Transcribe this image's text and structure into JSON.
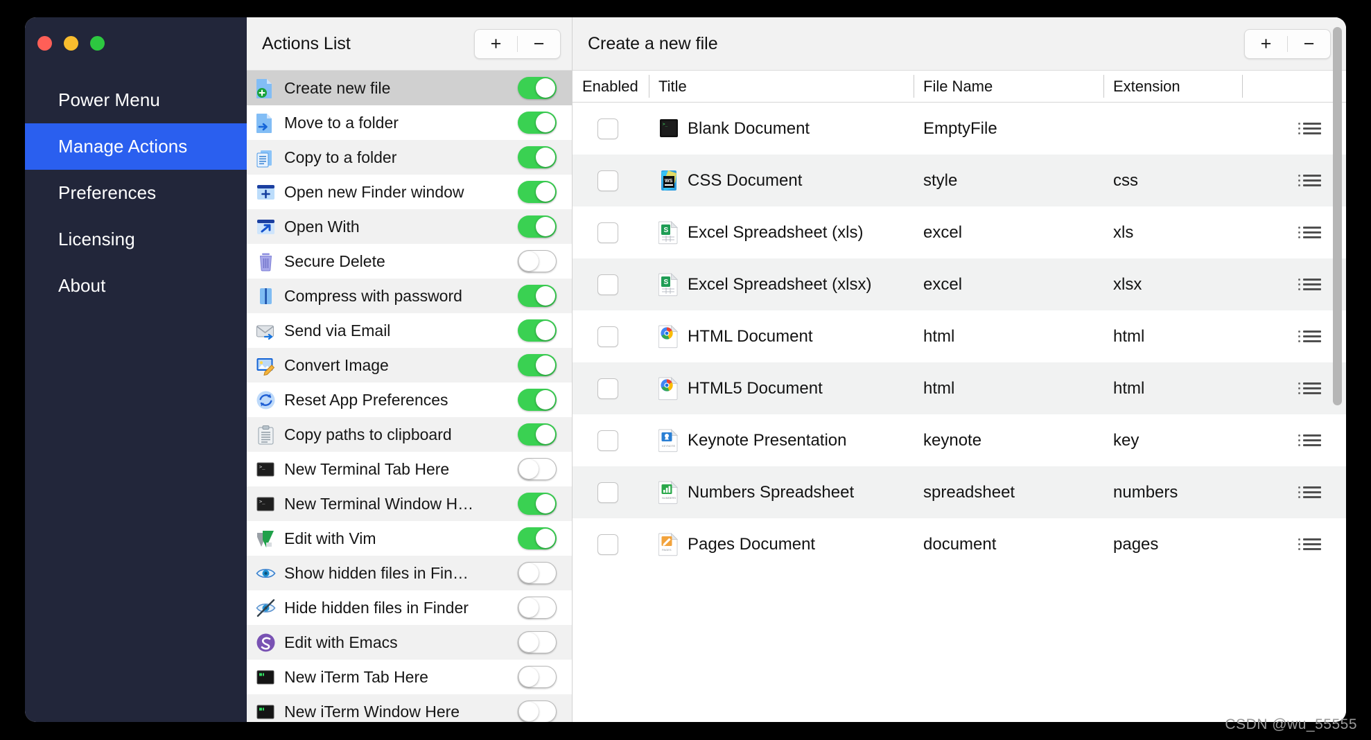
{
  "window": {
    "traffic_lights": [
      "close",
      "minimize",
      "zoom"
    ],
    "colors": {
      "sidebar_bg": "#22263a",
      "accent": "#2a5fef",
      "toggle_on": "#3ad152",
      "selected_row": "#d0d0d0"
    }
  },
  "sidebar": {
    "items": [
      {
        "label": "Power Menu",
        "active": false
      },
      {
        "label": "Manage Actions",
        "active": true
      },
      {
        "label": "Preferences",
        "active": false
      },
      {
        "label": "Licensing",
        "active": false
      },
      {
        "label": "About",
        "active": false
      }
    ]
  },
  "actions_panel": {
    "title": "Actions List",
    "add_label": "+",
    "remove_label": "−",
    "items": [
      {
        "label": "Create new file",
        "icon": "file-add-icon",
        "enabled": true,
        "selected": true
      },
      {
        "label": "Move to a folder",
        "icon": "file-move-icon",
        "enabled": true,
        "selected": false
      },
      {
        "label": "Copy to a folder",
        "icon": "file-copy-icon",
        "enabled": true,
        "selected": false
      },
      {
        "label": "Open new Finder window",
        "icon": "window-plus-icon",
        "enabled": true,
        "selected": false
      },
      {
        "label": "Open With",
        "icon": "open-with-arrow-icon",
        "enabled": true,
        "selected": false
      },
      {
        "label": "Secure Delete",
        "icon": "trash-icon",
        "enabled": false,
        "selected": false
      },
      {
        "label": "Compress with password",
        "icon": "archive-lock-icon",
        "enabled": true,
        "selected": false
      },
      {
        "label": "Send via Email",
        "icon": "envelope-send-icon",
        "enabled": true,
        "selected": false
      },
      {
        "label": "Convert Image",
        "icon": "image-edit-icon",
        "enabled": true,
        "selected": false
      },
      {
        "label": "Reset App Preferences",
        "icon": "refresh-circle-icon",
        "enabled": true,
        "selected": false
      },
      {
        "label": "Copy paths to clipboard",
        "icon": "clipboard-icon",
        "enabled": true,
        "selected": false
      },
      {
        "label": "New Terminal Tab Here",
        "icon": "terminal-icon",
        "enabled": false,
        "selected": false
      },
      {
        "label": "New Terminal Window H…",
        "icon": "terminal-icon",
        "enabled": true,
        "selected": false
      },
      {
        "label": "Edit with Vim",
        "icon": "vim-icon",
        "enabled": true,
        "selected": false
      },
      {
        "label": "Show hidden files in Fin…",
        "icon": "eye-icon",
        "enabled": false,
        "selected": false
      },
      {
        "label": "Hide hidden files in Finder",
        "icon": "eye-slash-icon",
        "enabled": false,
        "selected": false
      },
      {
        "label": "Edit with Emacs",
        "icon": "emacs-icon",
        "enabled": false,
        "selected": false
      },
      {
        "label": "New iTerm Tab Here",
        "icon": "iterm-icon",
        "enabled": false,
        "selected": false
      },
      {
        "label": "New iTerm Window Here",
        "icon": "iterm-icon",
        "enabled": false,
        "selected": false
      }
    ]
  },
  "detail_panel": {
    "title": "Create a new file",
    "add_label": "+",
    "remove_label": "−",
    "columns": [
      "Enabled",
      "Title",
      "File Name",
      "Extension",
      ""
    ],
    "rows": [
      {
        "enabled": false,
        "icon": "blank-terminal-doc-icon",
        "title": "Blank Document",
        "file_name": "EmptyFile",
        "extension": "",
        "menu": "row-menu-icon"
      },
      {
        "enabled": false,
        "icon": "webstorm-doc-icon",
        "title": "CSS Document",
        "file_name": "style",
        "extension": "css",
        "menu": "row-menu-icon"
      },
      {
        "enabled": false,
        "icon": "excel-doc-icon",
        "title": "Excel Spreadsheet (xls)",
        "file_name": "excel",
        "extension": "xls",
        "menu": "row-menu-icon"
      },
      {
        "enabled": false,
        "icon": "excel-doc-icon",
        "title": "Excel Spreadsheet (xlsx)",
        "file_name": "excel",
        "extension": "xlsx",
        "menu": "row-menu-icon"
      },
      {
        "enabled": false,
        "icon": "chrome-doc-icon",
        "title": "HTML Document",
        "file_name": "html",
        "extension": "html",
        "menu": "row-menu-icon"
      },
      {
        "enabled": false,
        "icon": "chrome-doc-icon",
        "title": "HTML5 Document",
        "file_name": "html",
        "extension": "html",
        "menu": "row-menu-icon"
      },
      {
        "enabled": false,
        "icon": "keynote-doc-icon",
        "title": "Keynote Presentation",
        "file_name": "keynote",
        "extension": "key",
        "menu": "row-menu-icon"
      },
      {
        "enabled": false,
        "icon": "numbers-doc-icon",
        "title": "Numbers Spreadsheet",
        "file_name": "spreadsheet",
        "extension": "numbers",
        "menu": "row-menu-icon"
      },
      {
        "enabled": false,
        "icon": "pages-doc-icon",
        "title": "Pages Document",
        "file_name": "document",
        "extension": "pages",
        "menu": "row-menu-icon"
      }
    ]
  },
  "watermark": {
    "text": "CSDN @wu_55555"
  }
}
